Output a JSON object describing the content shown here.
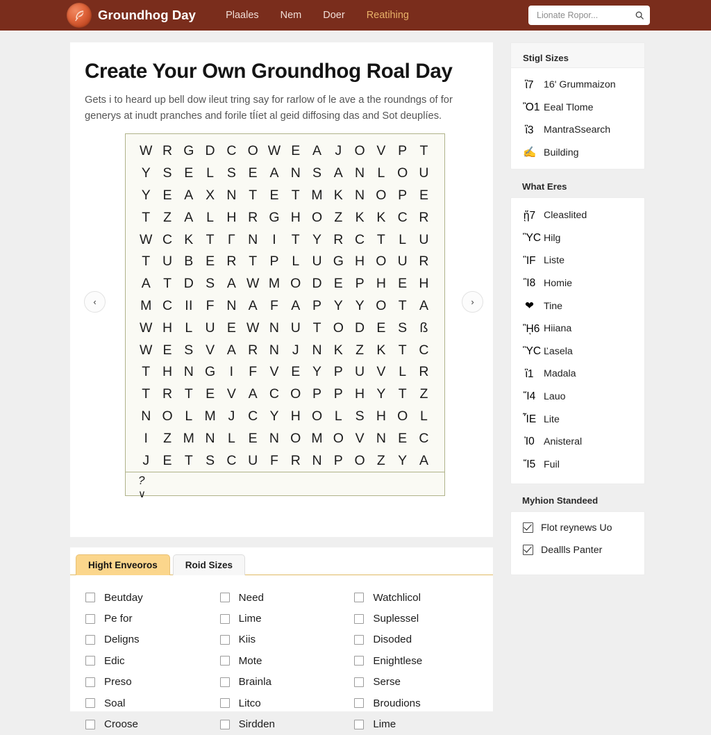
{
  "navbar": {
    "brand": "Groundhog Day",
    "logo_icon": "feather-badge-icon",
    "links": [
      {
        "label": "Plaales",
        "active": false
      },
      {
        "label": "Nem",
        "active": false
      },
      {
        "label": "Doer",
        "active": false
      },
      {
        "label": "Reatihing",
        "active": true
      }
    ],
    "search": {
      "placeholder": "Lionate Ropor...",
      "value": "",
      "icon": "search-icon"
    },
    "bg_color": "#7a2d1c",
    "active_link_color": "#e8b168"
  },
  "main": {
    "title": "Create Your Own Groundhog Roal Day",
    "lede": "Gets i to heard up bell dow ileut tring say for rarlow of le ave a the roundngs of for generys at inudt pranches and forile tÍíet al geid diffosing das and Sot deuplíes.",
    "prev_label": "‹",
    "next_label": "›",
    "grid": {
      "columns": 14,
      "rows": 15,
      "footer_marks": [
        "?",
        "∨"
      ],
      "border_color": "#b0b38a",
      "bg_color": "#fafaf4",
      "letters": [
        [
          "W",
          "R",
          "G",
          "D",
          "C",
          "O",
          "W",
          "E",
          "A",
          "J",
          "O",
          "V",
          "P",
          "T"
        ],
        [
          "Y",
          "S",
          "E",
          "L",
          "S",
          "E",
          "A",
          "N",
          "S",
          "A",
          "N",
          "L",
          "O",
          "U"
        ],
        [
          "Y",
          "E",
          "A",
          "X",
          "N",
          "T",
          "E",
          "T",
          "M",
          "K",
          "N",
          "O",
          "P",
          "E"
        ],
        [
          "T",
          "Z",
          "A",
          "L",
          "H",
          "R",
          "G",
          "H",
          "O",
          "Z",
          "K",
          "K",
          "C",
          "R"
        ],
        [
          "W",
          "C",
          "K",
          "T",
          "Γ",
          "N",
          "I",
          "T",
          "Y",
          "R",
          "C",
          "T",
          "L",
          "U"
        ],
        [
          "T",
          "U",
          "B",
          "E",
          "R",
          "T",
          "P",
          "L",
          "U",
          "G",
          "H",
          "O",
          "U",
          "R"
        ],
        [
          "A",
          "T",
          "D",
          "S",
          "A",
          "W",
          "M",
          "O",
          "D",
          "E",
          "P",
          "H",
          "E",
          "H"
        ],
        [
          "M",
          "C",
          "II",
          "F",
          "N",
          "A",
          "F",
          "A",
          "P",
          "Y",
          "Y",
          "O",
          "T",
          "A"
        ],
        [
          "W",
          "H",
          "L",
          "U",
          "E",
          "W",
          "N",
          "U",
          "T",
          "O",
          "D",
          "E",
          "S",
          "ß"
        ],
        [
          "W",
          "E",
          "S",
          "V",
          "A",
          "R",
          "N",
          "J",
          "N",
          "K",
          "Z",
          "K",
          "T",
          "C"
        ],
        [
          "T",
          "H",
          "N",
          "G",
          "I",
          "F",
          "V",
          "E",
          "Y",
          "P",
          "U",
          "V",
          "L",
          "R"
        ],
        [
          "T",
          "R",
          "T",
          "E",
          "V",
          "A",
          "C",
          "O",
          "P",
          "P",
          "H",
          "Y",
          "T",
          "Z"
        ],
        [
          "N",
          "O",
          "L",
          "M",
          "J",
          "C",
          "Y",
          "H",
          "O",
          "L",
          "S",
          "H",
          "O",
          "L"
        ],
        [
          "I",
          "Z",
          "M",
          "N",
          "L",
          "E",
          "N",
          "O",
          "M",
          "O",
          "V",
          "N",
          "E",
          "C"
        ],
        [
          "J",
          "E",
          "T",
          "S",
          "C",
          "U",
          "F",
          "R",
          "N",
          "P",
          "O",
          "Z",
          "Y",
          "A"
        ]
      ]
    }
  },
  "tabs": {
    "items": [
      {
        "label": "Hight Enveoros",
        "selected": true
      },
      {
        "label": "Roid Sizes",
        "selected": false
      }
    ],
    "accent_color": "#fbd68c",
    "underline_color": "#e0b964"
  },
  "checklist": {
    "items": [
      {
        "label": "Beutday",
        "checked": false
      },
      {
        "label": "Pe for",
        "checked": false
      },
      {
        "label": "Deligns",
        "checked": false
      },
      {
        "label": "Edic",
        "checked": false
      },
      {
        "label": "Preso",
        "checked": false
      },
      {
        "label": "Soal",
        "checked": false
      },
      {
        "label": "Croose",
        "checked": false
      },
      {
        "label": "Need",
        "checked": false
      },
      {
        "label": "Lime",
        "checked": false
      },
      {
        "label": "Kiis",
        "checked": false
      },
      {
        "label": "Mote",
        "checked": false
      },
      {
        "label": "Brainla",
        "checked": false
      },
      {
        "label": "Litco",
        "checked": false
      },
      {
        "label": "Sirdden",
        "checked": false
      },
      {
        "label": "Watchlicol",
        "checked": false
      },
      {
        "label": "Suplessel",
        "checked": false
      },
      {
        "label": "Disoded",
        "checked": false
      },
      {
        "label": "Enightlese",
        "checked": false
      },
      {
        "label": "Serse",
        "checked": false
      },
      {
        "label": "Broudions",
        "checked": false
      },
      {
        "label": "Lime",
        "checked": false
      }
    ]
  },
  "sidebar": {
    "sizes_panel": {
      "title": "Stigl Sizes",
      "items": [
        {
          "icon": "crocus-flower-icon",
          "glyph": "ἳ7",
          "label": "16' Grummaizon"
        },
        {
          "icon": "light-bulb-icon",
          "glyph": "Ὂ1",
          "label": "Eeal Tlome"
        },
        {
          "icon": "deciduous-tree-icon",
          "glyph": "ἳ3",
          "label": "MantraSsearch"
        },
        {
          "icon": "writing-hand-icon",
          "glyph": "✍",
          "label": "Building"
        }
      ]
    },
    "eres_panel": {
      "title": "What Eres",
      "items": [
        {
          "icon": "blue-bowl-icon",
          "glyph": "ᾕ7",
          "label": "Cleaslited"
        },
        {
          "icon": "photo-frame-icon",
          "glyph": "ὛC",
          "label": "Hilg"
        },
        {
          "icon": "blue-circle-person-icon",
          "glyph": "ἻF",
          "label": "Liste"
        },
        {
          "icon": "artist-palette-icon",
          "glyph": "Ἲ8",
          "label": "Homie"
        },
        {
          "icon": "red-heart-icon",
          "glyph": "❤",
          "label": "Tine"
        },
        {
          "icon": "groundhog-icon",
          "glyph": "ᾚ6",
          "label": "Hiiana"
        },
        {
          "icon": "portrait-photo-icon",
          "glyph": "ὛC",
          "label": "Ľasela"
        },
        {
          "icon": "green-seedling-icon",
          "glyph": "ἳ1",
          "label": "Madala"
        },
        {
          "icon": "snow-scene-icon",
          "glyph": "Ἵ4",
          "label": "Lauo"
        },
        {
          "icon": "red-lamp-icon",
          "glyph": "ἾE",
          "label": "Lite"
        },
        {
          "icon": "red-bow-icon",
          "glyph": "Ἰ0",
          "label": "Anisteral"
        },
        {
          "icon": "medal-icon",
          "glyph": "Ἴ5",
          "label": "Fuil"
        }
      ]
    },
    "standard_panel": {
      "title": "Myhion Standeed",
      "items": [
        {
          "label": "Flot reynews Uo",
          "checked": true
        },
        {
          "label": "Deallls Panter",
          "checked": true
        }
      ]
    }
  }
}
